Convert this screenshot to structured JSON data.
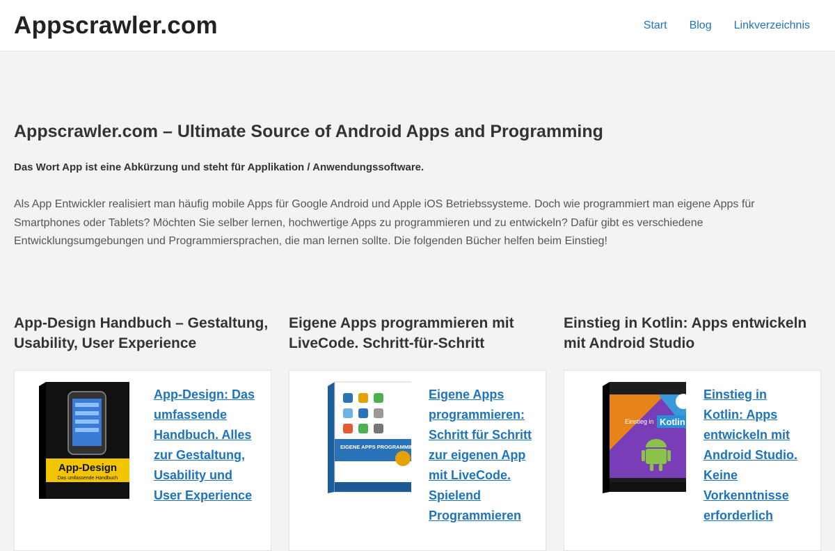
{
  "header": {
    "site_title": "Appscrawler.com",
    "nav": [
      "Start",
      "Blog",
      "Linkverzeichnis"
    ]
  },
  "intro": {
    "title": "Appscrawler.com – Ultimate Source of Android Apps and Programming",
    "bold": "Das Wort App ist eine Abkürzung und steht für Applikation / Anwendungssoftware.",
    "text": "Als App Entwickler realisiert man häufig mobile Apps für Google Android und Apple iOS Betriebssysteme. Doch wie programmiert man eigene Apps für Smartphones oder Tablets? Möchten Sie selber lernen, hochwertige Apps zu programmieren und zu entwickeln? Dafür gibt es verschiedene Entwicklungsumgebungen und Programmiersprachen, die man lernen sollte. Die folgenden Bücher helfen beim Einstieg!"
  },
  "books": [
    {
      "heading": "App-Design Handbuch – Gestaltung, Usability, User Experience",
      "link": "App-Design: Das umfassende Handbuch. Alles zur Gestaltung, Usability und User Experience",
      "cover_title": "App-Design",
      "cover_subtitle": "Das umfassende Handbuch",
      "cover_color": "#111111"
    },
    {
      "heading": "Eigene Apps programmieren mit LiveCode. Schritt-für-Schritt",
      "link": "Eigene Apps programmieren: Schritt für Schritt zur eigenen App mit LiveCode. Spielend Programmieren",
      "cover_title": "EIGENE APPS PROGRAMMIEREN",
      "cover_color": "#2a73b8"
    },
    {
      "heading": "Einstieg in Kotlin: Apps entwickeln mit Android Studio",
      "link": "Einstieg in Kotlin: Apps entwickeln mit Android Studio. Keine Vorkenntnisse erforderlich",
      "cover_title": "Einstieg in Kotlin",
      "cover_color": "#1d1d1d"
    }
  ]
}
